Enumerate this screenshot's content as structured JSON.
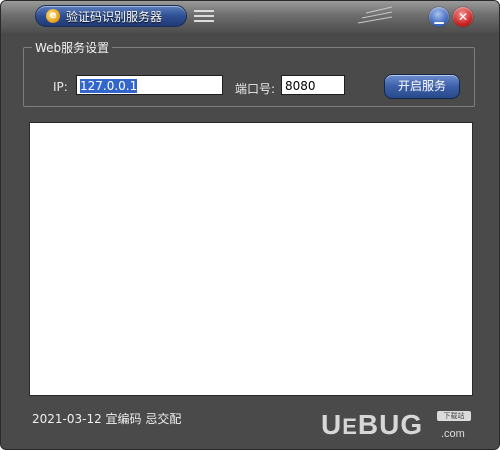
{
  "window": {
    "title": "验证码识别服务器",
    "app_icon": "ie-logo-icon",
    "menu_icon": "hamburger-menu-icon",
    "buttons": {
      "minimize": "minimize-icon",
      "close": "close-icon"
    }
  },
  "web_settings": {
    "group_title": "Web服务设置",
    "ip_label": "IP:",
    "ip_value": "127.0.0.1",
    "port_label": "端口号:",
    "port_value": "8080",
    "start_button": "开启服务"
  },
  "log": {
    "lines": []
  },
  "status": {
    "text": "2021-03-12 宜编码  忌交配"
  },
  "watermark": {
    "logo": "UEBUG",
    "domain": ".com",
    "badge": "下载站"
  },
  "colors": {
    "window_bg": "#4a4a4a",
    "accent_blue": "#3c5fa8",
    "close_red": "#cc2222"
  }
}
